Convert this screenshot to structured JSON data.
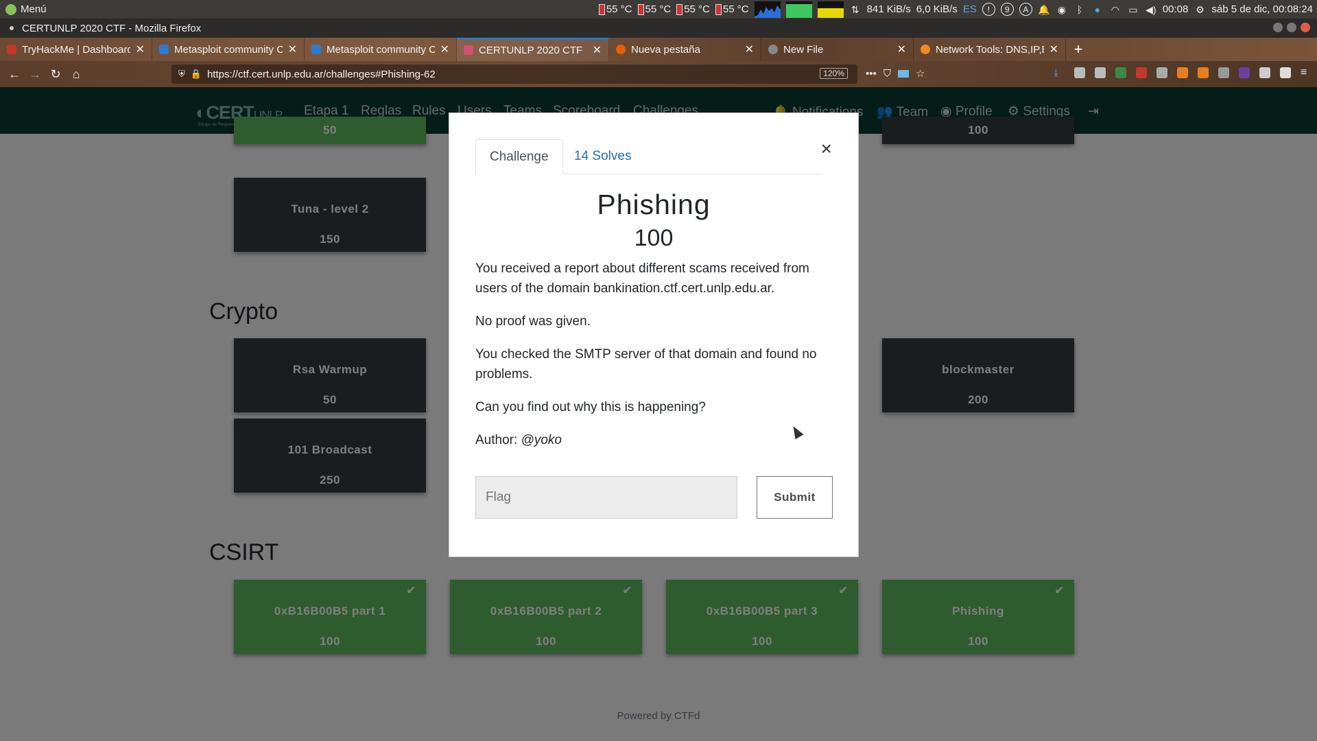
{
  "os_panel": {
    "menu_label": "Menú",
    "temps": [
      "55 °C",
      "55 °C",
      "55 °C",
      "55 °C"
    ],
    "net_down": "841 KiB/s",
    "net_up": "6,0 KiB/s",
    "keyboard_layout": "ES",
    "circled_badges": [
      "!",
      "9",
      "A"
    ],
    "time": "00:08",
    "datetime": "sáb  5 de dic, 00:08:24"
  },
  "browser": {
    "window_title": "CERTUNLP 2020 CTF - Mozilla Firefox",
    "tabs": [
      {
        "label": "TryHackMe | Dashboard",
        "favicon_color": "#c0392b"
      },
      {
        "label": "Metasploit community C",
        "favicon_color": "#2e7bcf"
      },
      {
        "label": "Metasploit community C",
        "favicon_color": "#2e7bcf"
      },
      {
        "label": "CERTUNLP 2020 CTF",
        "favicon_color": "#d35270"
      },
      {
        "label": "Nueva pestaña",
        "favicon_color": "#e66000"
      },
      {
        "label": "New File",
        "favicon_color": "#888888"
      },
      {
        "label": "Network Tools: DNS,IP,E",
        "favicon_color": "#f08a24"
      }
    ],
    "url": "https://ctf.cert.unlp.edu.ar/challenges#Phishing-62",
    "zoom": "120%"
  },
  "site": {
    "logo_main": "CERT",
    "logo_suffix": "UNLP",
    "logo_tagline": "Equipo de Respuesta a Incidentes de Seguridad",
    "nav": [
      "Etapa 1",
      "Reglas",
      "Rules",
      "Users",
      "Teams",
      "Scoreboard",
      "Challenges",
      "Notifications",
      "Team",
      "Profile",
      "Settings"
    ],
    "categories": {
      "crypto": "Crypto",
      "csirt": "CSIRT"
    },
    "cards_top": [
      {
        "name": "",
        "points": "50",
        "solved": true
      },
      {
        "name": "",
        "points": "100",
        "solved": false
      },
      {
        "name": "Tuna - level 2",
        "points": "150",
        "solved": false
      }
    ],
    "cards_crypto": [
      {
        "name": "Rsa Warmup",
        "points": "50"
      },
      {
        "name": "blockmaster",
        "points": "200"
      },
      {
        "name": "101 Broadcast",
        "points": "250"
      }
    ],
    "cards_csirt": [
      {
        "name": "0xB16B00B5 part 1",
        "points": "100"
      },
      {
        "name": "0xB16B00B5 part 2",
        "points": "100"
      },
      {
        "name": "0xB16B00B5 part 3",
        "points": "100"
      },
      {
        "name": "Phishing",
        "points": "100"
      }
    ],
    "footer": "Powered by CTFd"
  },
  "modal": {
    "tab_challenge": "Challenge",
    "tab_solves": "14 Solves",
    "close_glyph": "×",
    "title": "Phishing",
    "points": "100",
    "desc": [
      "You received a report about different scams received from users of the domain bankination.ctf.cert.unlp.edu.ar.",
      "No proof was given.",
      "You checked the SMTP server of that domain and found no problems.",
      "Can you find out why this is happening?"
    ],
    "author_label": "Author: ",
    "author_name": "@yoko",
    "flag_placeholder": "Flag",
    "submit_label": "Submit"
  }
}
